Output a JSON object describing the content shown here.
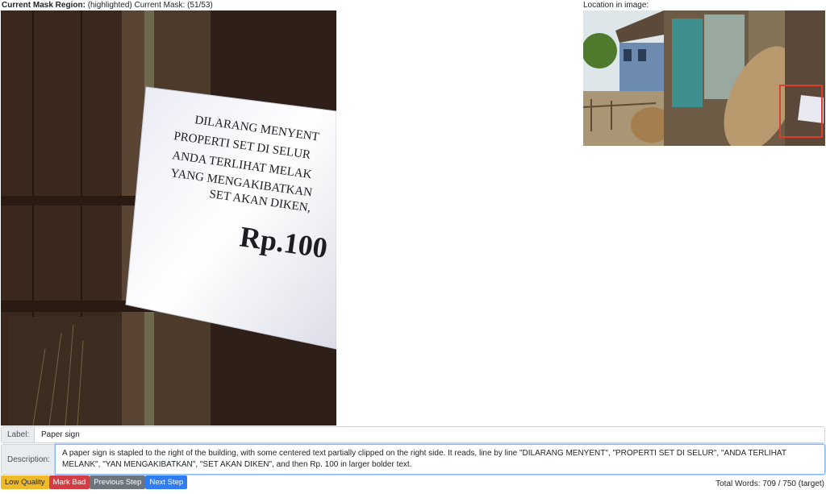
{
  "header": {
    "region_label": "Current Mask Region:",
    "region_note": "(highlighted) Current Mask: (51/53)",
    "location_label": "Location in image:"
  },
  "crop_image": {
    "sign_lines": [
      "DILARANG MENYENT",
      "PROPERTI SET DI SELUR",
      "ANDA TERLIHAT MELAK",
      "YANG MENGAKIBATKAN",
      "SET AKAN DIKEN,",
      "Rp.100"
    ]
  },
  "form": {
    "label_addon": "Label:",
    "label_value": "Paper sign",
    "description_addon": "Description:",
    "description_value": "A paper sign is stapled to the right of the building, with some centered text partially clipped on the right side. It reads, line by line \"DILARANG MENYENT\", \"PROPERTI SET DI SELUR\", \"ANDA TERLIHAT MELANK\", \"YAN MENGAKIBATKAN\", \"SET AKAN DIKEN\", and then Rp. 100 in larger bolder text."
  },
  "buttons": {
    "low_quality": "Low Quality",
    "mark_bad": "Mark Bad",
    "previous": "Previous Step",
    "next": "Next Step"
  },
  "footer": {
    "total_words": "Total Words: 709 / 750 (target)"
  },
  "colors": {
    "highlight_box": "#e23b2e",
    "primary": "#2f7df5",
    "warning": "#f0b92a",
    "danger": "#d13d43",
    "secondary": "#6c757d"
  }
}
